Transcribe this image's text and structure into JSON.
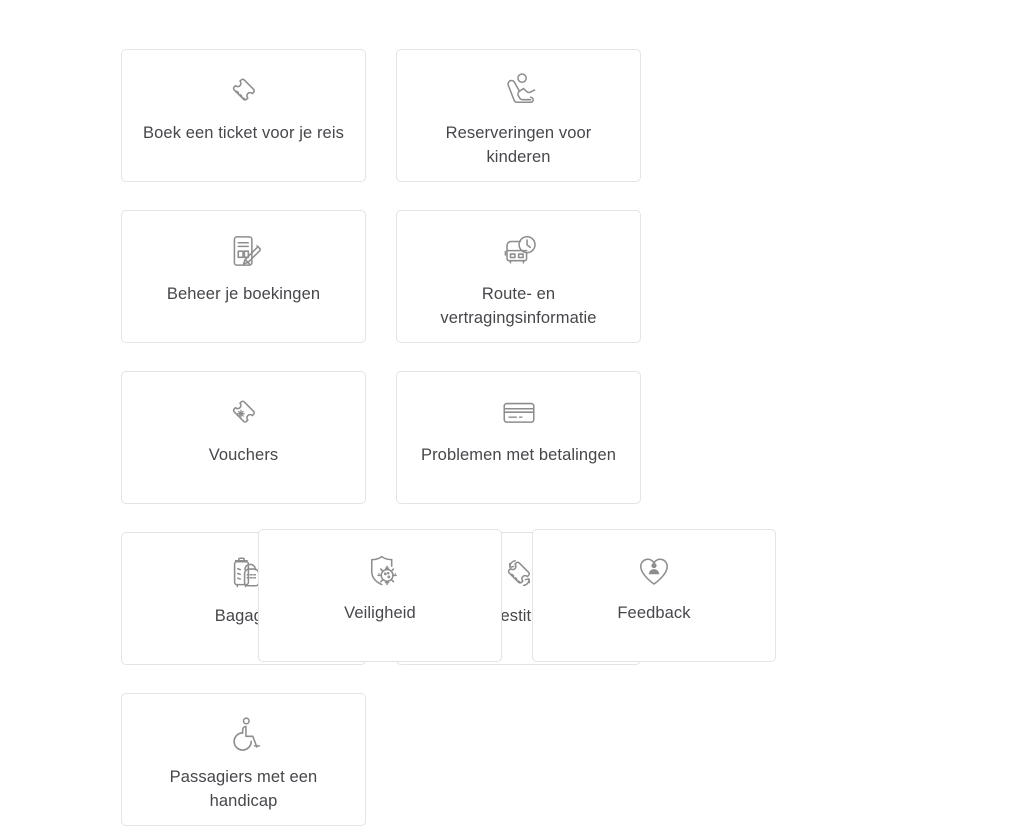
{
  "page": {
    "background_color": "#ffffff",
    "card_border_color": "#e4e4e6",
    "icon_stroke_color": "#8d8d90",
    "label_text_color": "#45474b"
  },
  "help_topics": {
    "rows": [
      [
        {
          "label": "Boek een ticket voor je reis",
          "icon": "ticket-icon"
        },
        {
          "label": "Reserveringen voor kinderen",
          "icon": "child-seat-icon"
        },
        {
          "label": "Beheer je boekingen",
          "icon": "document-pencil-icon"
        }
      ],
      [
        {
          "label": "Route- en vertragingsinformatie",
          "icon": "bus-clock-icon"
        },
        {
          "label": "Vouchers",
          "icon": "voucher-star-ticket-icon"
        },
        {
          "label": "Problemen met betalingen",
          "icon": "credit-card-icon"
        }
      ],
      [
        {
          "label": "Bagage",
          "icon": "luggage-backpack-icon"
        },
        {
          "label": "Vraag restitutie aan",
          "icon": "ticket-refund-arrows-icon"
        },
        {
          "label": "Passagiers met een handicap",
          "icon": "wheelchair-icon"
        }
      ],
      [
        {
          "label": "Veiligheid",
          "icon": "shield-virus-icon"
        },
        {
          "label": "Feedback",
          "icon": "heart-person-icon"
        }
      ]
    ]
  }
}
